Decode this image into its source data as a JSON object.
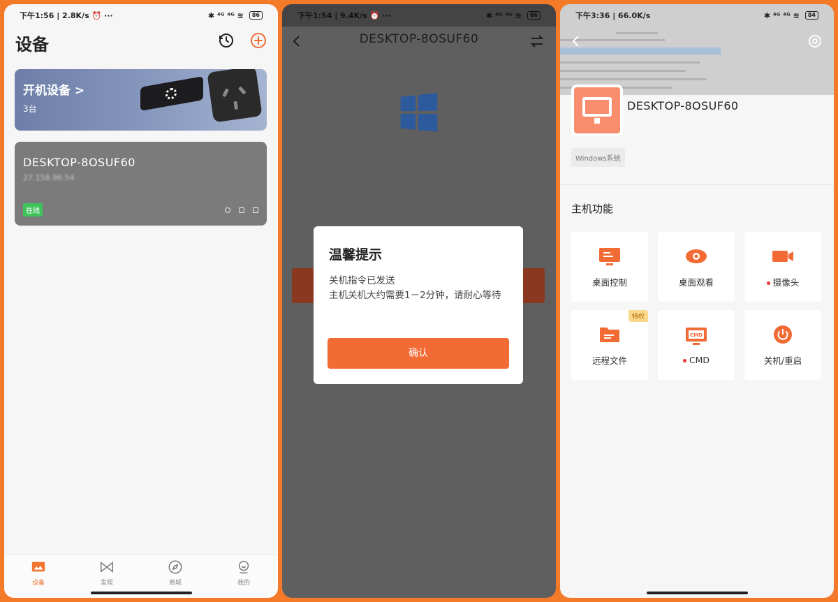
{
  "panel1": {
    "status": {
      "left": "下午1:56 | 2.8K/s ⏰ ···",
      "right": "✱ ⁴ᴳ ⁴ᴳ ≋",
      "battery": "86"
    },
    "title": "设备",
    "card_on": {
      "title": "开机设备 >",
      "count": "3台"
    },
    "pc_card": {
      "name": "DESKTOP-8OSUF60",
      "ip": "27.158.96.54",
      "badge": "在线"
    },
    "tabs": [
      {
        "label": "设备"
      },
      {
        "label": "发现"
      },
      {
        "label": "商城"
      },
      {
        "label": "我的"
      }
    ]
  },
  "panel2": {
    "status": {
      "left": "下午1:54 | 9.4K/s ⏰ ···",
      "right": "✱ ⁴ᴳ ⁴ᴳ ≋",
      "battery": "86"
    },
    "title": "DESKTOP-8OSUF60",
    "dialog": {
      "title": "温馨提示",
      "line1": "关机指令已发送",
      "line2": "主机关机大约需要1－2分钟，请耐心等待",
      "ok": "确认"
    }
  },
  "panel3": {
    "status": {
      "left": "下午3:36 | 66.0K/s",
      "right": "✱ ⁴ᴳ ⁴ᴳ ≋",
      "battery": "84"
    },
    "name": "DESKTOP-8OSUF60",
    "os_tag": "Windows系统",
    "section": "主机功能",
    "functions": [
      {
        "label": "桌面控制"
      },
      {
        "label": "桌面观看"
      },
      {
        "label": "摄像头"
      },
      {
        "label": "远程文件",
        "badge": "特权"
      },
      {
        "label": "CMD"
      },
      {
        "label": "关机/重启"
      }
    ]
  },
  "colors": {
    "accent": "#f26b35",
    "online": "#3fc35a",
    "frame": "#f47a2a"
  }
}
